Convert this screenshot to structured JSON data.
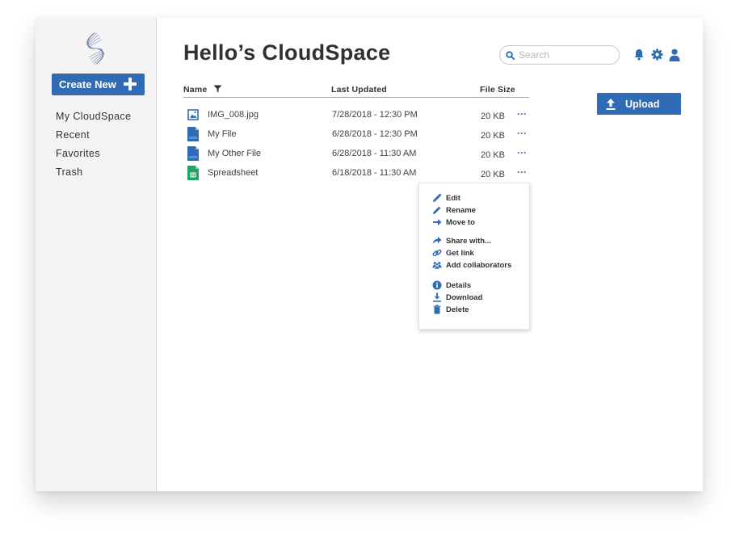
{
  "sidebar": {
    "create_label": "Create New",
    "items": [
      "My CloudSpace",
      "Recent",
      "Favorites",
      "Trash"
    ]
  },
  "header": {
    "title": "Hello’s CloudSpace",
    "search_placeholder": "Search"
  },
  "toolbar": {
    "upload_label": "Upload"
  },
  "table": {
    "columns": [
      "Name",
      "Last Updated",
      "File Size"
    ],
    "rows": [
      {
        "name": "IMG_008.jpg",
        "updated": "7/28/2018 - 12:30 PM",
        "size": "20 KB",
        "type": "image-file-icon"
      },
      {
        "name": "My File",
        "updated": "6/28/2018 - 12:30 PM",
        "size": "20 KB",
        "type": "doc-file-icon"
      },
      {
        "name": "My Other File",
        "updated": "6/28/2018 - 11:30 AM",
        "size": "20 KB",
        "type": "doc-file-icon"
      },
      {
        "name": "Spreadsheet",
        "updated": "6/18/2018 - 11:30 AM",
        "size": "20 KB",
        "type": "spreadsheet-file-icon"
      }
    ],
    "more_label": "···"
  },
  "context_menu": {
    "items": [
      "Edit",
      "Rename",
      "Move to",
      "Share with...",
      "Get link",
      "Add collaborators",
      "Details",
      "Download",
      "Delete"
    ]
  },
  "colors": {
    "accent": "#2f6cb5",
    "doc": "#2f6cb5",
    "sheet": "#1fa463"
  }
}
